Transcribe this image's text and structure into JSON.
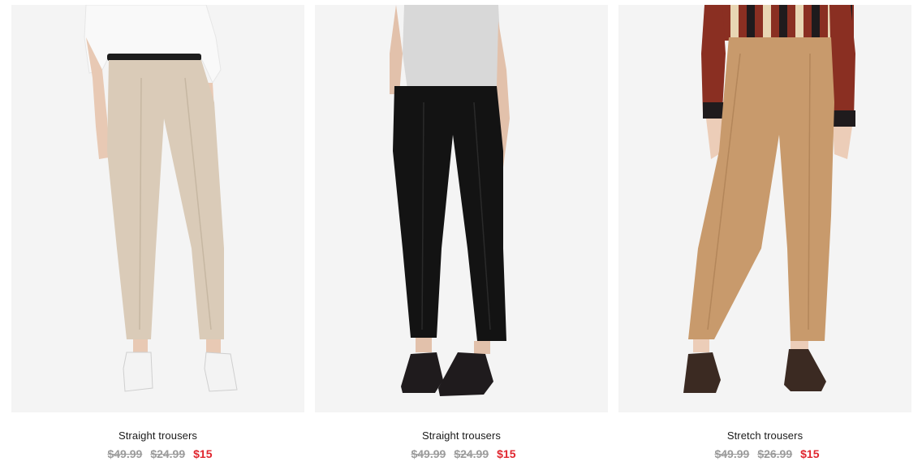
{
  "products": [
    {
      "name": "Straight trousers",
      "original_price": "$49.99",
      "previous_price": "$24.99",
      "sale_price": "$15",
      "image_alt": "beige-straight-trousers-photo",
      "trouser_color": "#d9cbb8",
      "top_color": "#f7f7f7",
      "shoe_color": "#f2f2f2"
    },
    {
      "name": "Straight trousers",
      "original_price": "$49.99",
      "previous_price": "$24.99",
      "sale_price": "$15",
      "image_alt": "black-straight-trousers-photo",
      "trouser_color": "#121212",
      "top_color": "#d6d6d6",
      "shoe_color": "#1e1a1c"
    },
    {
      "name": "Stretch trousers",
      "original_price": "$49.99",
      "previous_price": "$26.99",
      "sale_price": "$15",
      "image_alt": "camel-stretch-trousers-photo",
      "trouser_color": "#c89a6c",
      "top_color": "#8a2f22",
      "shoe_color": "#3b2a22"
    }
  ],
  "colors": {
    "sale_price": "#e0262f",
    "old_price": "#9b9b9b",
    "photo_background": "#f4f4f4"
  }
}
